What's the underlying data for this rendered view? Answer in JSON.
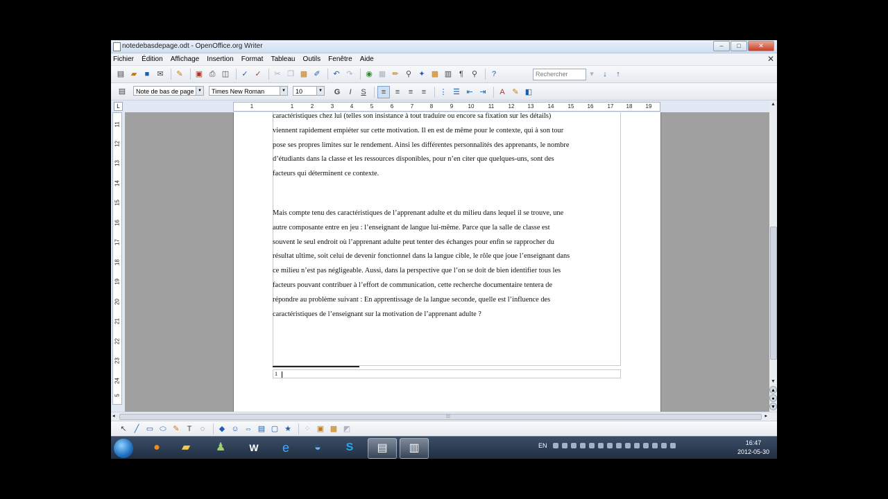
{
  "window": {
    "title": "notedebasdepage.odt - OpenOffice.org Writer"
  },
  "menu": [
    "Fichier",
    "Édition",
    "Affichage",
    "Insertion",
    "Format",
    "Tableau",
    "Outils",
    "Fenêtre",
    "Aide"
  ],
  "toolbar": {
    "search_placeholder": "Rechercher"
  },
  "formatting": {
    "style": "Note de bas de page",
    "font": "Times New Roman",
    "size": "10",
    "bold": "G",
    "italic": "I",
    "underline": "S"
  },
  "ruler": {
    "h_labels": [
      "1",
      "1",
      "2",
      "3",
      "4",
      "5",
      "6",
      "7",
      "8",
      "9",
      "10",
      "11",
      "12",
      "13",
      "14",
      "15",
      "16",
      "17",
      "18",
      "19"
    ],
    "v_labels": [
      "11",
      "12",
      "13",
      "14",
      "15",
      "16",
      "17",
      "18",
      "19",
      "20",
      "21",
      "22",
      "23",
      "24",
      "5"
    ]
  },
  "document": {
    "para1": [
      "caractéristiques chez lui (telles son insistance à tout traduire ou encore sa fixation sur les détails)",
      "viennent rapidement empiéter sur cette motivation. Il en est de même pour le contexte, qui à son tour",
      "pose ses propres limites sur le rendement.  Ainsi les différentes personnalités des apprenants, le nombre",
      "d’étudiants dans la classe et les ressources disponibles, pour n’en citer que quelques-uns, sont des",
      "facteurs qui déterminent ce contexte."
    ],
    "para2": [
      "Mais compte tenu des caractéristiques de l’apprenant adulte et du milieu dans lequel il se trouve, une",
      "autre composante entre en jeu : l’enseignant de langue lui-même. Parce que la salle de classe est",
      "souvent le seul endroit où l’apprenant adulte peut tenter des échanges pour enfin se rapprocher du",
      "résultat ultime, soit celui de devenir fonctionnel dans la langue cible, le rôle que joue l’enseignant dans",
      "ce milieu n’est pas négligeable. Aussi, dans la perspective que l’on se doit de bien identifier tous les",
      "facteurs pouvant contribuer à l’effort de communication, cette recherche documentaire tentera de",
      "répondre au problème suivant : En apprentissage de la langue seconde, quelle est l’influence des",
      "caractéristiques de l’enseignant sur la motivation de l’apprenant adulte ?"
    ],
    "footnote_number": "1"
  },
  "taskbar": {
    "lang": "EN",
    "time": "16:47",
    "date": "2012-05-30"
  }
}
